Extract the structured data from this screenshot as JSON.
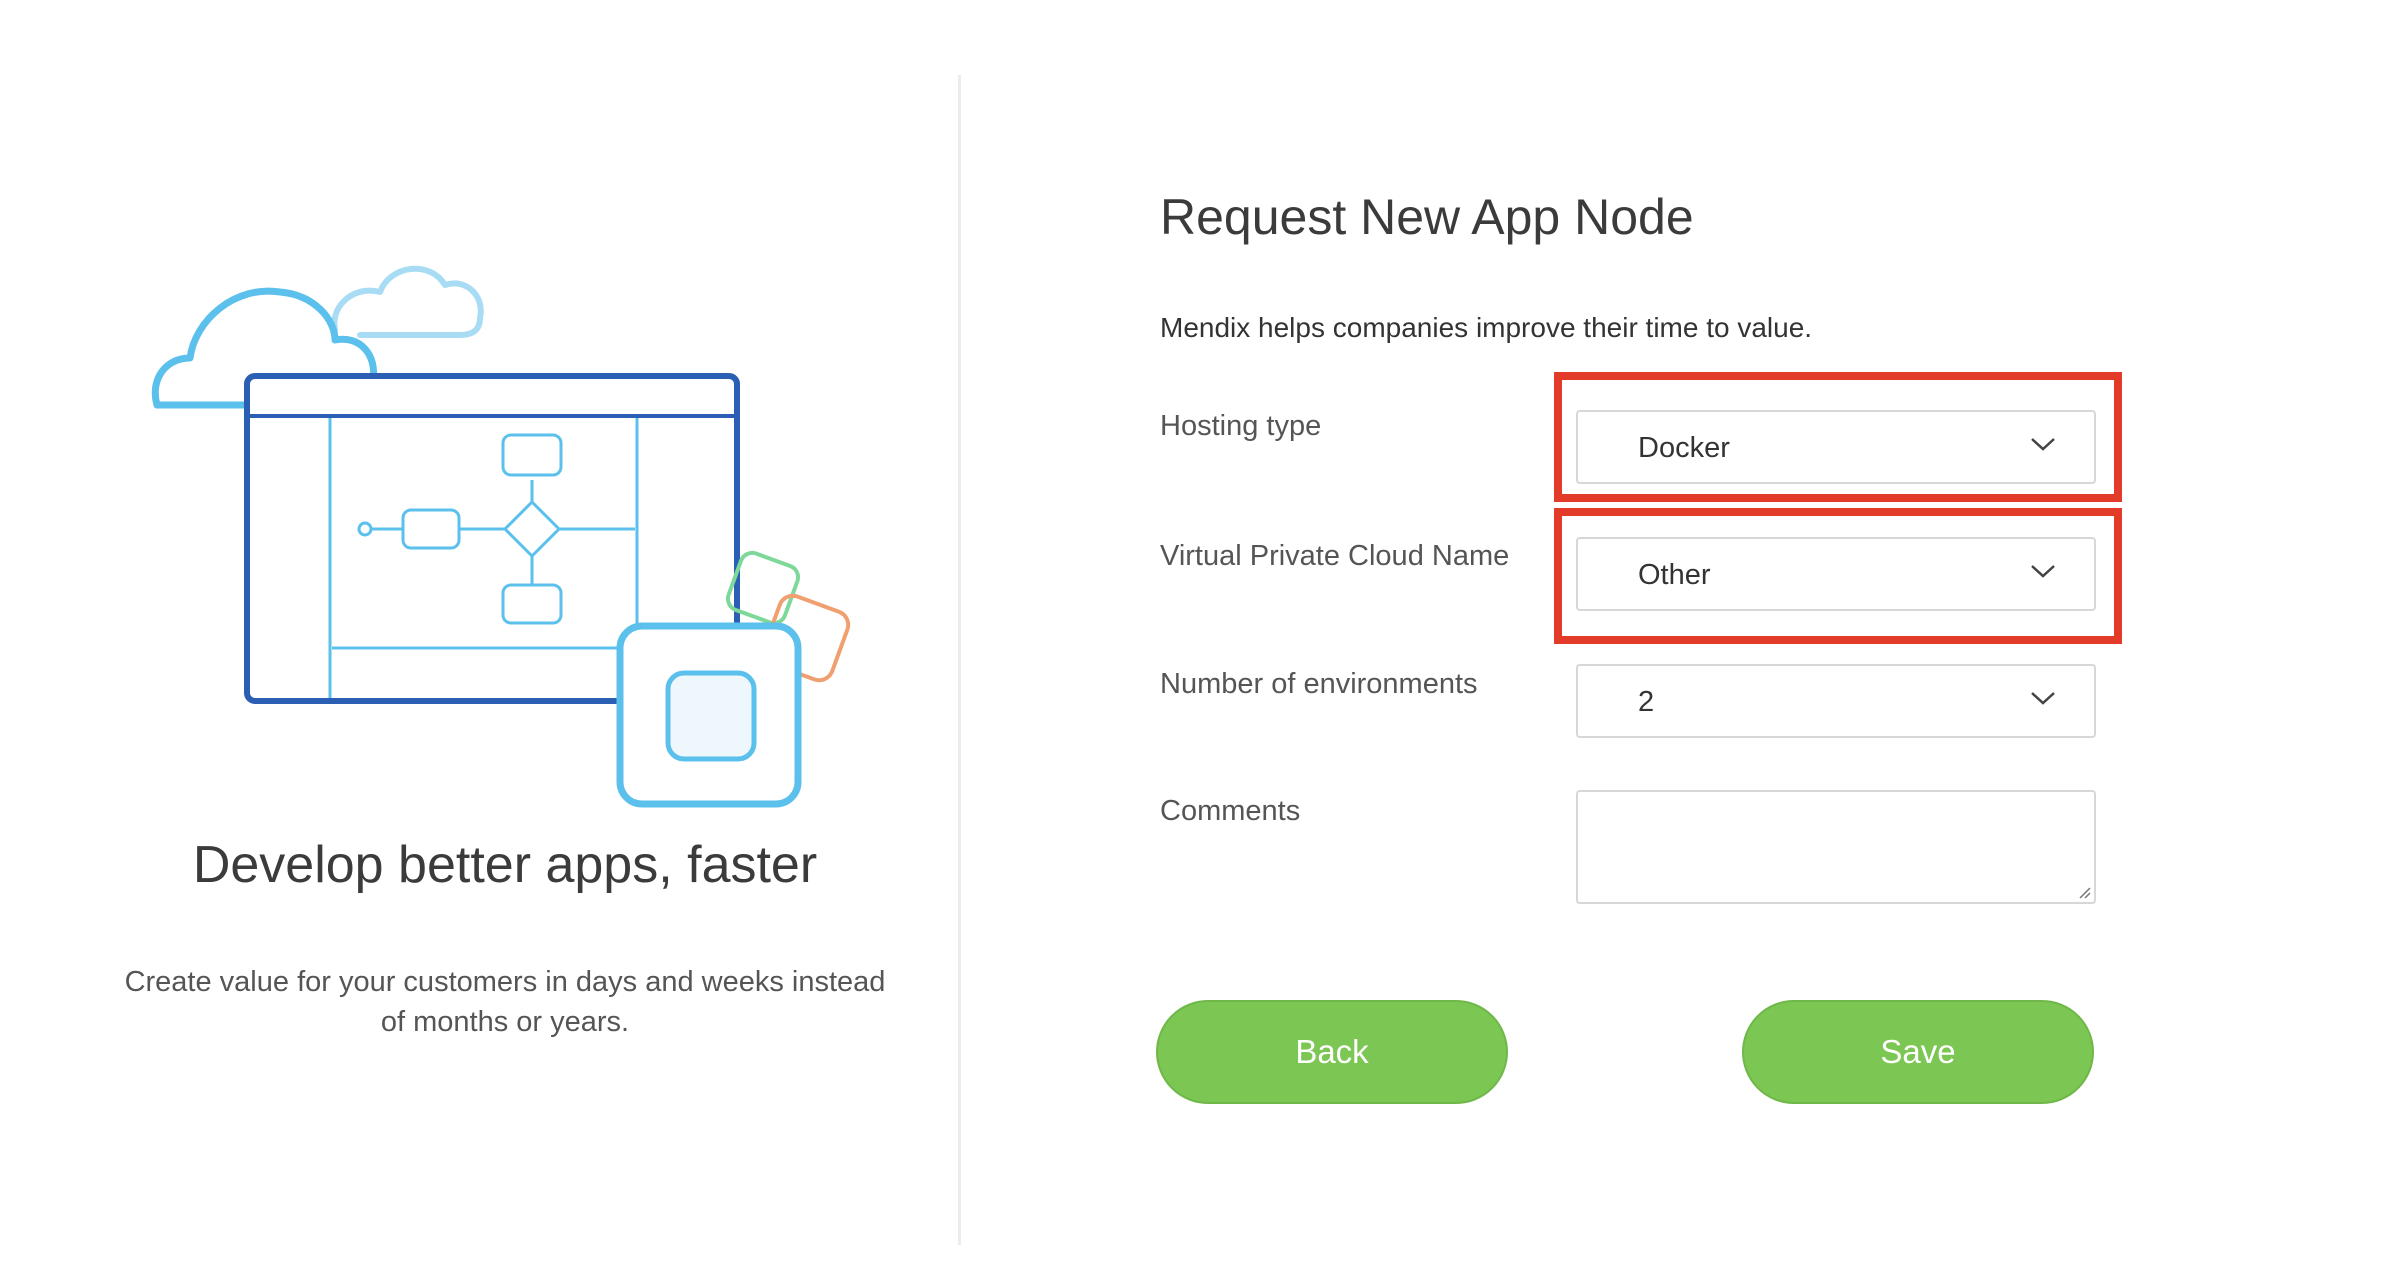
{
  "left": {
    "tagline": "Develop better apps, faster",
    "subtext": "Create value for your customers in days and weeks instead of months or years."
  },
  "form": {
    "title": "Request New App Node",
    "description": "Mendix helps companies improve their time to value.",
    "fields": {
      "hosting_type": {
        "label": "Hosting type",
        "value": "Docker"
      },
      "vpc_name": {
        "label": "Virtual Private Cloud Name",
        "value": "Other"
      },
      "environments": {
        "label": "Number of environments",
        "value": "2"
      },
      "comments": {
        "label": "Comments",
        "value": ""
      }
    },
    "buttons": {
      "back": "Back",
      "save": "Save"
    }
  },
  "colors": {
    "button_green": "#7cc653",
    "highlight_red": "#e23b2a",
    "illustration_dark_blue": "#2b5fb3",
    "illustration_light_blue": "#5bc0eb",
    "icon_green": "#7ed89a",
    "icon_orange": "#f0a070"
  },
  "icons": [
    "cloud-icon",
    "chevron-down-icon",
    "resize-handle-icon"
  ]
}
